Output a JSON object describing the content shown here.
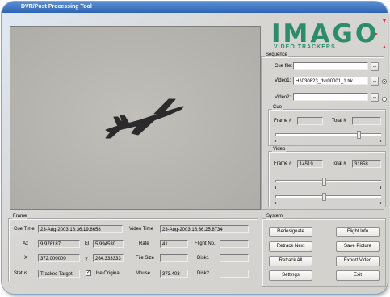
{
  "window": {
    "title": "DVR/Post Processing Tool"
  },
  "logo": {
    "brand": "IMAGO",
    "tagline": "VIDEO TRACKERS",
    "accent": "#2c8c6c",
    "marker_color": "#d23a3a"
  },
  "sequence": {
    "title": "Sequence",
    "cue_file_label": "Cue file:",
    "cue_file_value": "",
    "video1_label": "Video1:",
    "video1_value": "H:\\030823_dvr00001_1.trk",
    "video2_label": "Video2:",
    "video2_value": "",
    "browse_label": "...",
    "selected_video": "video1"
  },
  "cue": {
    "title": "Cue",
    "frame_label": "Frame #",
    "frame_value": "",
    "total_label": "Total #",
    "total_value": "",
    "slider_position": 0.8
  },
  "video": {
    "title": "Video",
    "frame_label": "Frame #",
    "frame_value": "14519",
    "total_label": "Total #",
    "total_value": "31858",
    "slider1_position": 0.46,
    "slider2_position": 0.46
  },
  "frame": {
    "title": "Frame",
    "cue_time_label": "Cue Time",
    "cue_time_value": "23-Aug-2003 18:36:19.8658",
    "video_time_label": "Video Time",
    "video_time_value": "23-Aug-2003 16:36:25.8734",
    "az_label": "Az",
    "az_value": "9.978187",
    "el_label": "El",
    "el_value": "5.994530",
    "rate_label": "Rate",
    "rate_value": "41",
    "flight_no_label": "Flight No.",
    "flight_no_value": "",
    "x_label": "X",
    "x_value": "372.000000",
    "y_label": "Y",
    "y_value": "264.333333",
    "file_size_label": "File Size",
    "file_size_value": "",
    "disk1_label": "Disk1",
    "disk1_value": "",
    "status_label": "Status",
    "status_value": "Tracked Target",
    "use_original_label": "Use Original",
    "use_original_checked": true,
    "mouse_label": "Mouse",
    "mouse_value": "373.403",
    "disk2_label": "Disk2",
    "disk2_value": ""
  },
  "system": {
    "title": "System",
    "buttons": {
      "redesignate": "Redesignate",
      "flight_info": "Flight Info",
      "retrack_next": "Retrack Next",
      "save_picture": "Save Picture",
      "retrack_all": "Retrack All",
      "export_video": "Export Video",
      "settings": "Settings",
      "exit": "Exit"
    }
  }
}
